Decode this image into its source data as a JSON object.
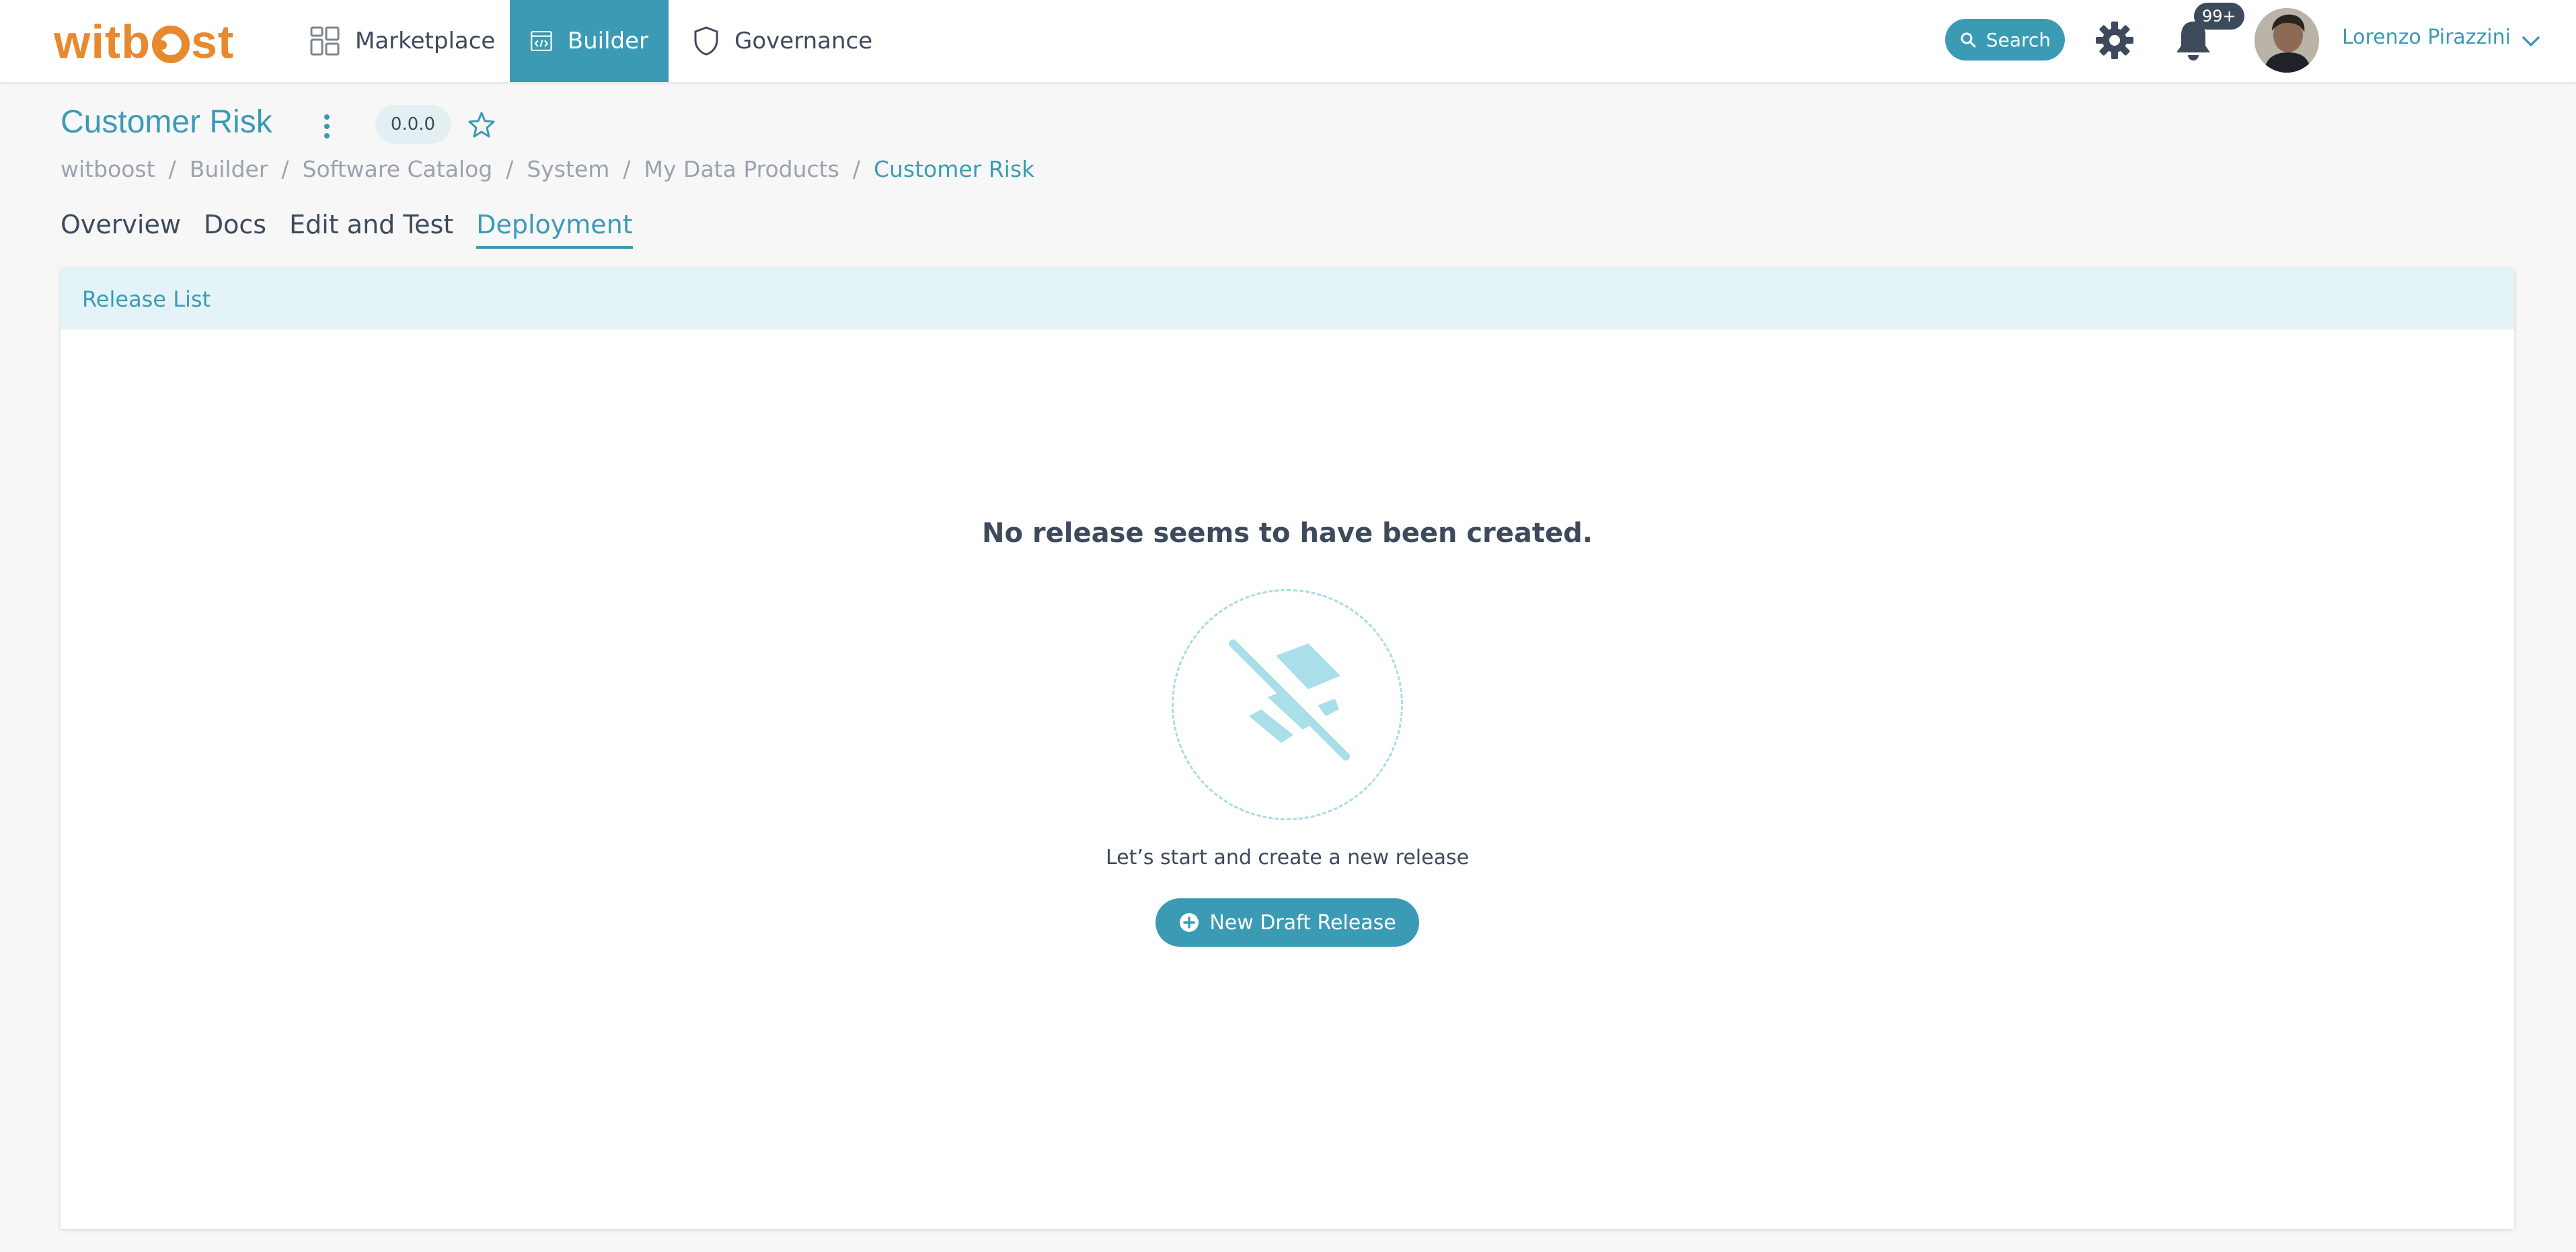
{
  "app": {
    "logo_text_pre": "witb",
    "logo_text_post": "st"
  },
  "nav": {
    "marketplace": "Marketplace",
    "builder": "Builder",
    "governance": "Governance"
  },
  "header": {
    "search_label": "Search",
    "notifications_badge": "99+",
    "user_name": "Lorenzo Pirazzini"
  },
  "page": {
    "title": "Customer Risk",
    "version": "0.0.0",
    "breadcrumb": [
      "witboost",
      "Builder",
      "Software Catalog",
      "System",
      "My Data Products",
      "Customer Risk"
    ]
  },
  "tabs": [
    "Overview",
    "Docs",
    "Edit and Test",
    "Deployment"
  ],
  "active_tab": "Deployment",
  "release_list": {
    "header": "Release List",
    "empty_title": "No release seems to have been created.",
    "empty_subtitle": "Let’s start and create a new release",
    "new_button": "New Draft Release"
  },
  "colors": {
    "accent": "#3b9bb5",
    "brand": "#e8892f",
    "text": "#3d4a5c",
    "muted": "#9aa3ad",
    "card_header_bg": "#e4f3f7"
  },
  "icons": {
    "marketplace": "grid-icon",
    "builder": "code-window-icon",
    "governance": "shield-icon",
    "search": "search-icon",
    "settings": "gear-icon",
    "notifications": "bell-icon",
    "user_menu": "chevron-down-icon",
    "more": "kebab-icon",
    "favorite": "star-icon",
    "empty_state": "layers-off-icon",
    "add": "plus-circle-icon"
  }
}
